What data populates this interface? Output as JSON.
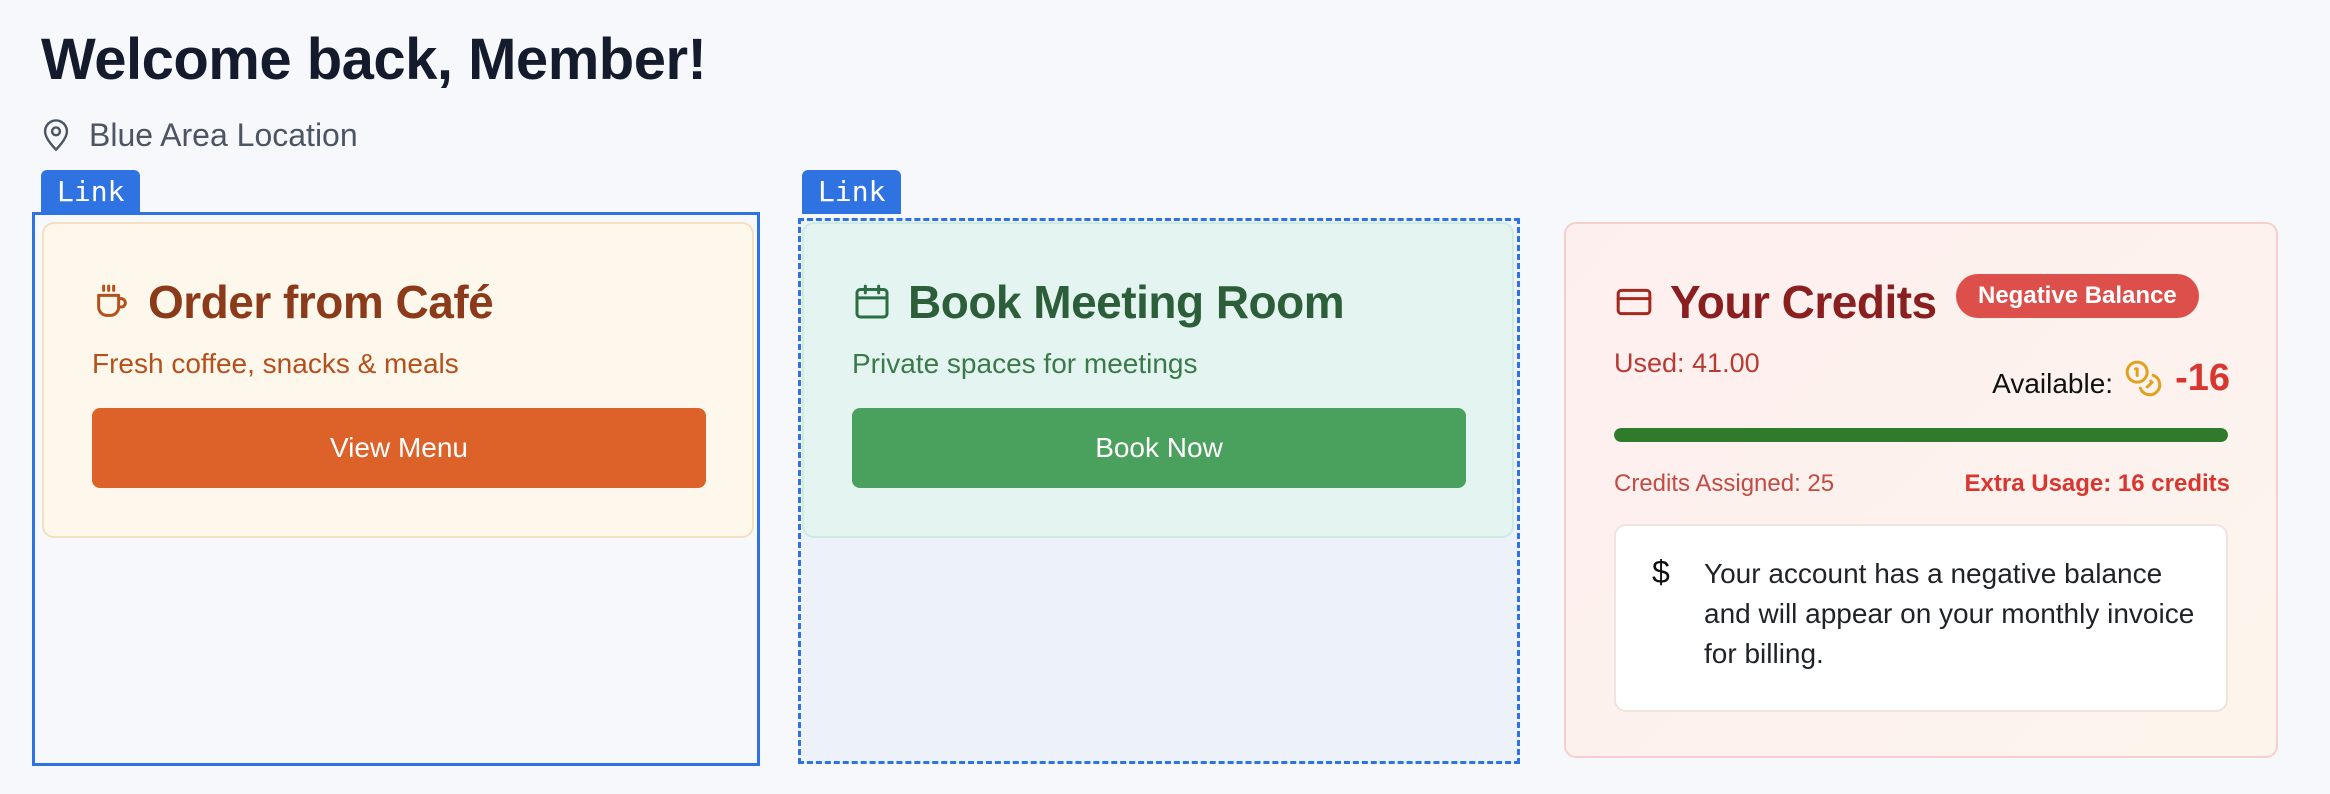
{
  "header": {
    "title": "Welcome back, Member!",
    "location": "Blue Area Location",
    "location_icon": "map-pin-icon"
  },
  "overlay_tags": {
    "link_1": "Link",
    "link_2": "Link"
  },
  "cafe_card": {
    "icon": "coffee-cup-icon",
    "title": "Order from Café",
    "subtitle": "Fresh coffee, snacks & meals",
    "button_label": "View Menu",
    "colors": {
      "title": "#8b3a1a",
      "subtitle": "#b4501c",
      "button": "#dc6229"
    }
  },
  "meeting_card": {
    "icon": "calendar-icon",
    "title": "Book Meeting Room",
    "subtitle": "Private spaces for meetings",
    "button_label": "Book Now",
    "colors": {
      "title": "#2c5e3a",
      "subtitle": "#3a7a4a",
      "button": "#4aa05d"
    }
  },
  "credits_card": {
    "icon": "credit-card-icon",
    "title": "Your Credits",
    "badge": "Negative Balance",
    "used_label": "Used: 41.00",
    "available_label": "Available:",
    "available_icon": "coins-icon",
    "available_value": "-16",
    "progress_fraction": 1.0,
    "assigned_label": "Credits Assigned: 25",
    "extra_label": "Extra Usage: 16 credits",
    "notice_icon": "dollar-icon",
    "notice_symbol": "$",
    "notice_text": "Your account has a negative balance and will appear on your monthly invoice for billing.",
    "colors": {
      "title": "#8a1f1f",
      "badge": "#dd4f4a",
      "value": "#d9362f",
      "bar": "#2f7a2b"
    }
  }
}
